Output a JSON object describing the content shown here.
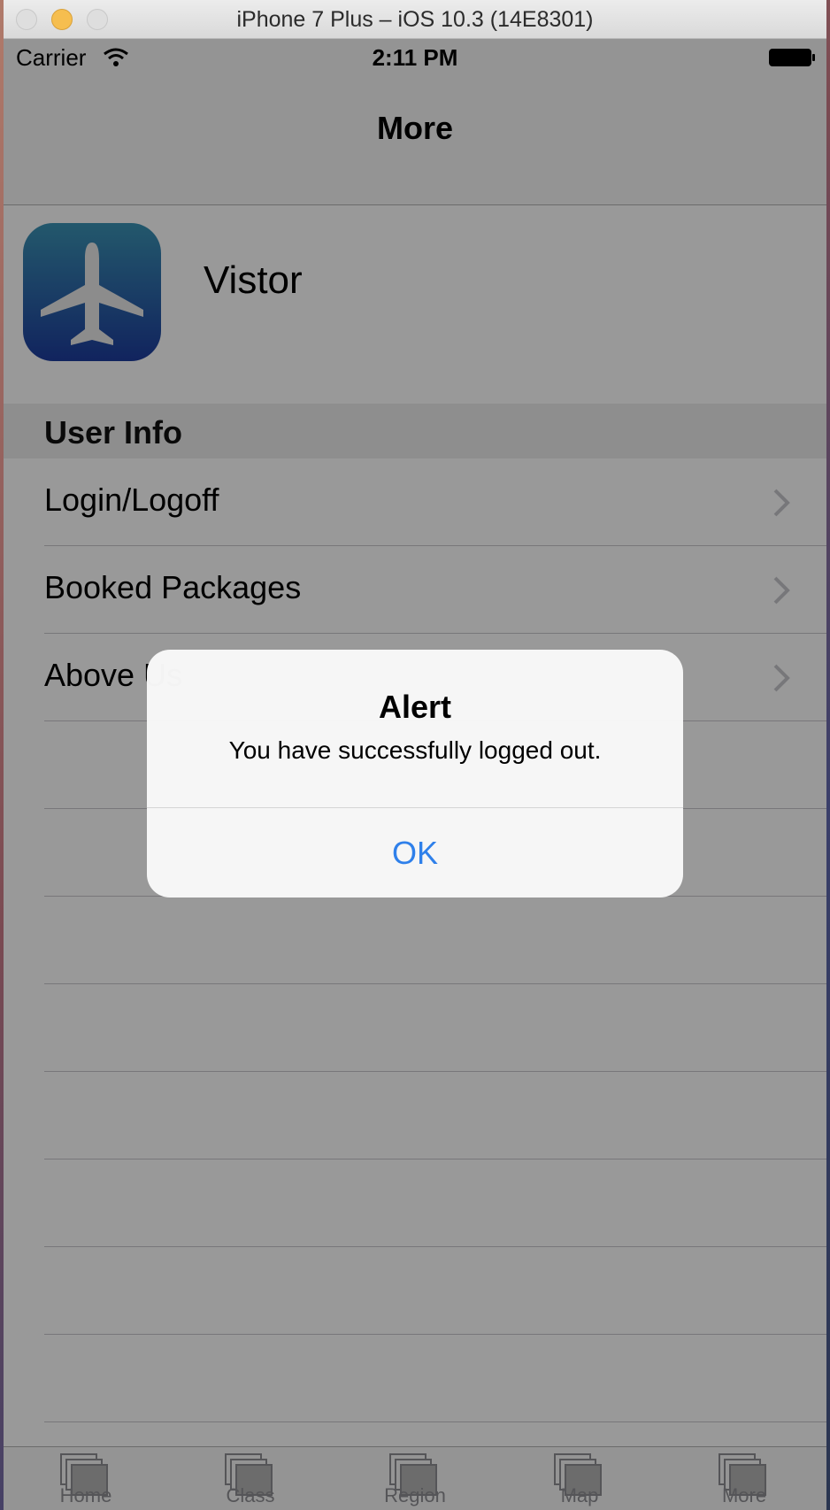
{
  "window": {
    "title": "iPhone 7 Plus – iOS 10.3 (14E8301)"
  },
  "status_bar": {
    "carrier": "Carrier",
    "time": "2:11 PM"
  },
  "nav": {
    "title": "More"
  },
  "profile": {
    "name": "Vistor",
    "icon": "airplane-icon"
  },
  "section": {
    "title": "User Info"
  },
  "menu": {
    "items": [
      {
        "label": "Login/Logoff"
      },
      {
        "label": "Booked Packages"
      },
      {
        "label": "Above Us"
      }
    ]
  },
  "tabs": [
    {
      "label": "Home"
    },
    {
      "label": "Class"
    },
    {
      "label": "Region"
    },
    {
      "label": "Map"
    },
    {
      "label": "More"
    }
  ],
  "alert": {
    "title": "Alert",
    "message": "You have successfully logged out.",
    "ok_label": "OK"
  },
  "colors": {
    "accent": "#2f80ea",
    "icon_gradient_top": "#3b93b4",
    "icon_gradient_bottom": "#1d3c9d",
    "tab_gray": "#8e8e93"
  }
}
